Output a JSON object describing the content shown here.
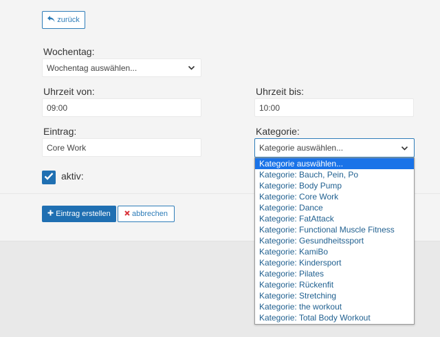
{
  "back_button": {
    "label": "zurück",
    "icon": "reply-icon"
  },
  "form": {
    "wochentag": {
      "label": "Wochentag:",
      "value": "Wochentag auswählen..."
    },
    "uhrzeit_von": {
      "label": "Uhrzeit von:",
      "value": "09:00"
    },
    "uhrzeit_bis": {
      "label": "Uhrzeit bis:",
      "value": "10:00"
    },
    "eintrag": {
      "label": "Eintrag:",
      "value": "Core Work"
    },
    "kategorie": {
      "label": "Kategorie:",
      "value": "Kategorie auswählen...",
      "options": [
        "Kategorie auswählen...",
        "Kategorie: Bauch, Pein, Po",
        "Kategorie: Body Pump",
        "Kategorie: Core Work",
        "Kategorie: Dance",
        "Kategorie: FatAttack",
        "Kategorie: Functional Muscle Fitness",
        "Kategorie: Gesundheitssport",
        "Kategorie: KamiBo",
        "Kategorie: Kindersport",
        "Kategorie: Pilates",
        "Kategorie: Rückenfit",
        "Kategorie: Stretching",
        "Kategorie: the workout",
        "Kategorie: Total Body Workout"
      ],
      "selected_index": 0
    },
    "aktiv": {
      "label": "aktiv:",
      "checked": true
    }
  },
  "actions": {
    "create_label": "Eintrag erstellen",
    "cancel_label": "abbrechen"
  },
  "colors": {
    "accent": "#1f6fb2",
    "cancel_icon": "#d9343b",
    "dropdown_highlight": "#1a73e8"
  }
}
